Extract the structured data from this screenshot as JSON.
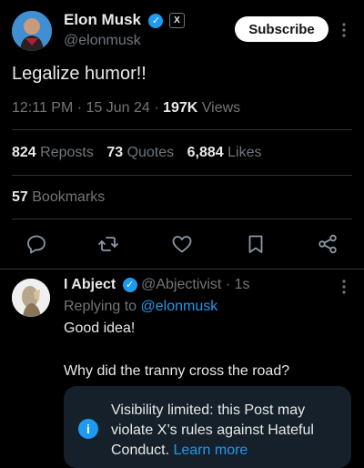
{
  "post": {
    "author_name": "Elon Musk",
    "author_handle": "@elonmusk",
    "subscribe_label": "Subscribe",
    "text": "Legalize humor!!",
    "time": "12:11 PM",
    "date": "15 Jun 24",
    "views_count": "197K",
    "views_label": "Views",
    "reposts_count": "824",
    "reposts_label": "Reposts",
    "quotes_count": "73",
    "quotes_label": "Quotes",
    "likes_count": "6,884",
    "likes_label": "Likes",
    "bookmarks_count": "57",
    "bookmarks_label": "Bookmarks",
    "actions": [
      "reply-icon",
      "repost-icon",
      "like-icon",
      "bookmark-icon",
      "share-icon"
    ]
  },
  "reply": {
    "author_name": "I Abject",
    "author_handle": "@Abjectivist",
    "time_ago": "1s",
    "replying_prefix": "Replying to",
    "replying_handle": "@elonmusk",
    "line1": "Good idea!",
    "line2": "Why did the tranny cross the road?",
    "notice_line1": "Visibility limited: this Post may",
    "notice_line2": "violate X’s rules against Hateful",
    "notice_line3": "Conduct.",
    "learn_more": "Learn more"
  },
  "colors": {
    "background": "#000000",
    "accent_blue": "#1d9bf0",
    "muted": "#71767b",
    "divider": "#2f3336",
    "notice_bg": "#16202a"
  }
}
